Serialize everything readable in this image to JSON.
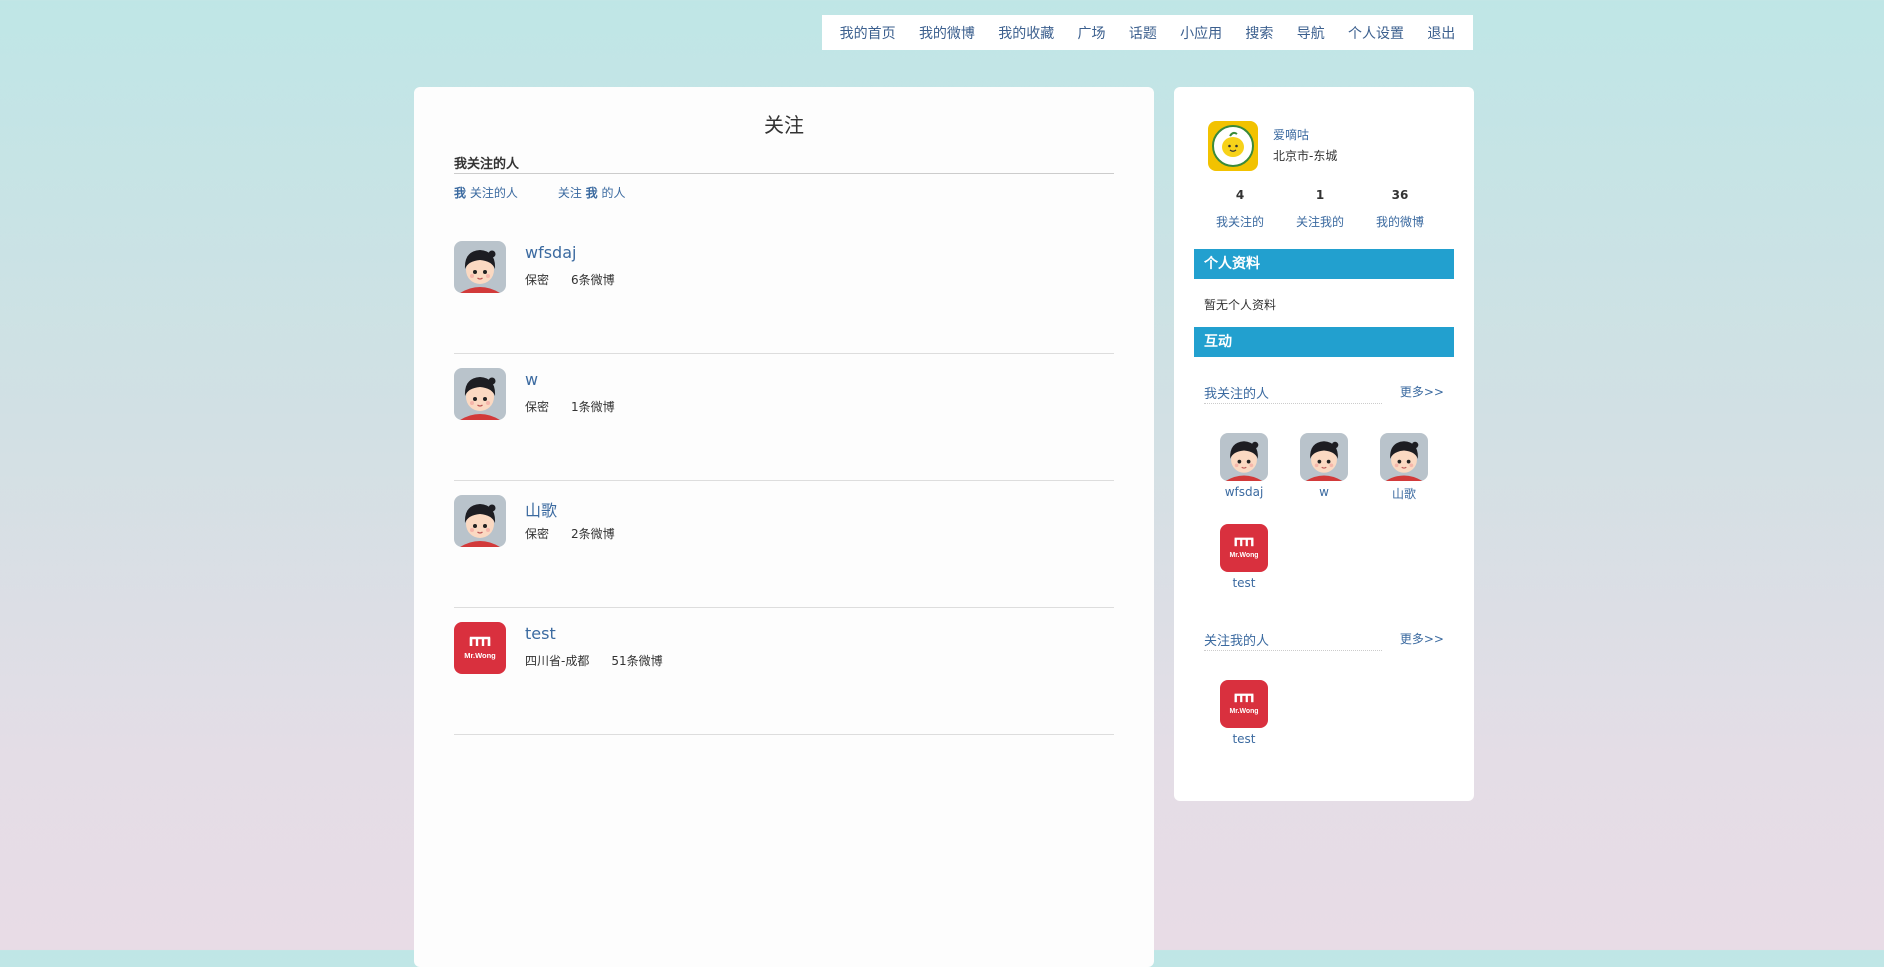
{
  "nav": [
    "我的首页",
    "我的微博",
    "我的收藏",
    "广场",
    "话题",
    "小应用",
    "搜索",
    "导航",
    "个人设置",
    "退出"
  ],
  "main": {
    "title": "关注",
    "section_head": "我关注的人",
    "tab1_a": "我",
    "tab1_b": " 关注的人",
    "tab2_a": "关注 ",
    "tab2_b": "我",
    "tab2_c": " 的人",
    "items": [
      {
        "name": "wfsdaj",
        "location": "保密",
        "posts": "6条微博",
        "avatar": "cartoon"
      },
      {
        "name": "w",
        "location": "保密",
        "posts": "1条微博",
        "avatar": "cartoon"
      },
      {
        "name": "山歌",
        "location": "保密",
        "posts": "2条微博",
        "avatar": "cartoon"
      },
      {
        "name": "test",
        "location": "四川省-成都",
        "posts": "51条微博",
        "avatar": "mrwong"
      }
    ]
  },
  "side": {
    "user_name": "爱嘀咕",
    "user_location": "北京市-东城",
    "stats": [
      {
        "num": "4",
        "label": "我关注的"
      },
      {
        "num": "1",
        "label": "关注我的"
      },
      {
        "num": "36",
        "label": "我的微博"
      }
    ],
    "profile_title": "个人资料",
    "profile_empty": "暂无个人资料",
    "interact_title": "互动",
    "following_title": "我关注的人",
    "followers_title": "关注我的人",
    "more": "更多>>",
    "following": [
      {
        "name": "wfsdaj",
        "avatar": "cartoon"
      },
      {
        "name": "w",
        "avatar": "cartoon"
      },
      {
        "name": "山歌",
        "avatar": "cartoon"
      },
      {
        "name": "test",
        "avatar": "mrwong"
      }
    ],
    "followers": [
      {
        "name": "test",
        "avatar": "mrwong"
      }
    ],
    "logo_text": "Mr.Wong"
  },
  "colors": {
    "accent_bar": "#22a0cf",
    "link": "#3b6aa0",
    "brand_red": "#d9303e"
  }
}
